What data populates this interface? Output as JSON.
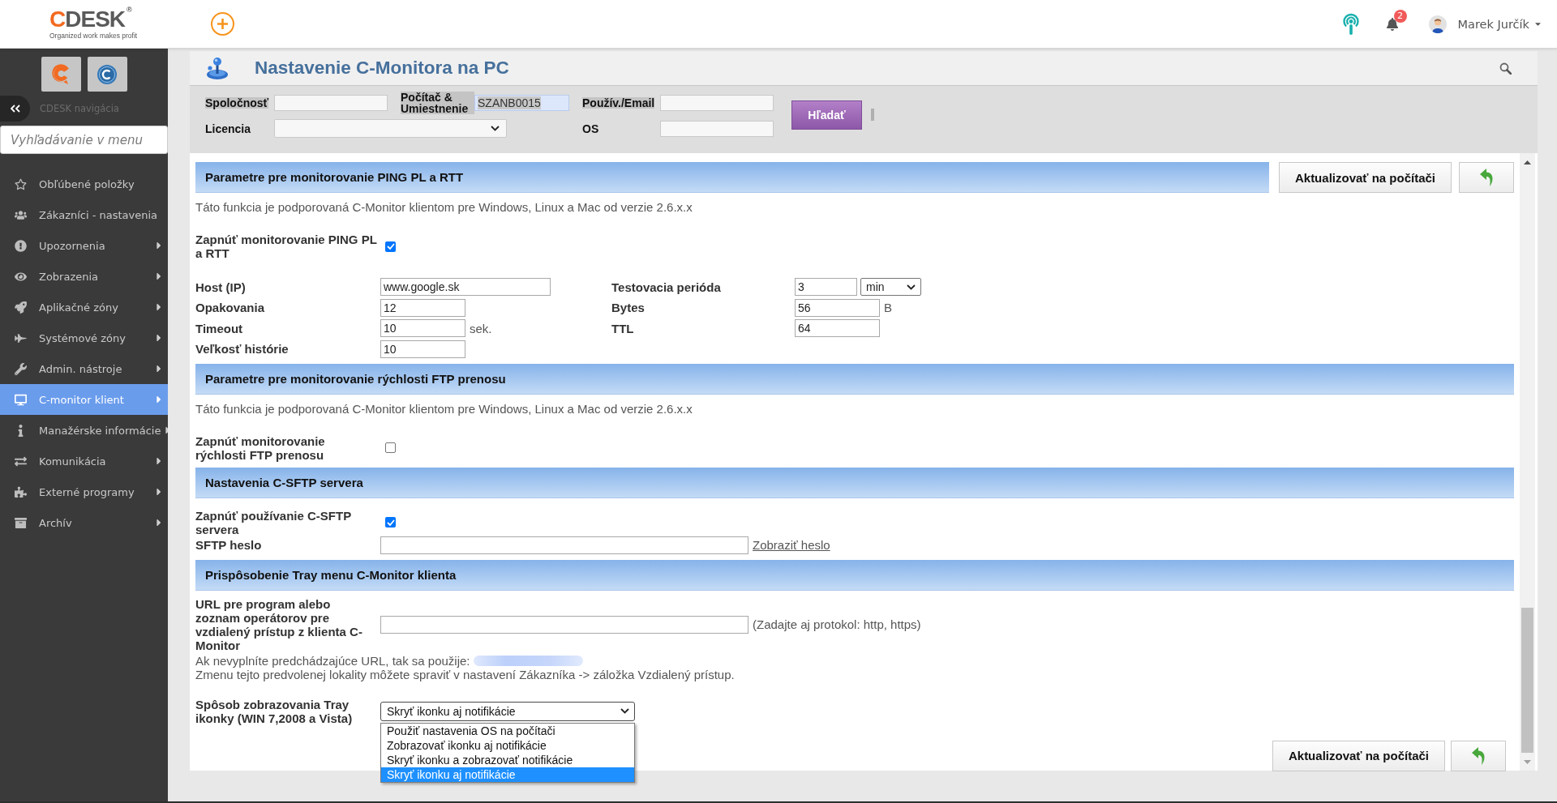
{
  "header": {
    "logo": {
      "accent": "C",
      "text": "DESK",
      "mark": "®",
      "tagline": "Organized work makes profit"
    },
    "notifications": {
      "count": "2"
    },
    "user": {
      "name": "Marek Jurčík"
    }
  },
  "sidebar": {
    "title": "CDESK navigácia",
    "search": {
      "placeholder": "Vyhľadávanie v menu"
    },
    "items": [
      {
        "label": "Obľúbené položky",
        "submenu": false,
        "selected": false
      },
      {
        "label": "Zákazníci - nastavenia",
        "submenu": false,
        "selected": false
      },
      {
        "label": "Upozornenia",
        "submenu": true,
        "selected": false
      },
      {
        "label": "Zobrazenia",
        "submenu": true,
        "selected": false
      },
      {
        "label": "Aplikačné zóny",
        "submenu": true,
        "selected": false
      },
      {
        "label": "Systémové zóny",
        "submenu": true,
        "selected": false
      },
      {
        "label": "Admin. nástroje",
        "submenu": true,
        "selected": false
      },
      {
        "label": "C-monitor klient",
        "submenu": true,
        "selected": true
      },
      {
        "label": "Manažérske informácie",
        "submenu": true,
        "selected": false
      },
      {
        "label": "Komunikácia",
        "submenu": true,
        "selected": false
      },
      {
        "label": "Externé programy",
        "submenu": true,
        "selected": false
      },
      {
        "label": "Archív",
        "submenu": true,
        "selected": false
      }
    ]
  },
  "page": {
    "title": "Nastavenie C-Monitora na PC"
  },
  "filters": {
    "fields": [
      {
        "label": "Spoločnosť",
        "kind": "input",
        "highlighted": true,
        "autofilled": false
      },
      {
        "label": "Počítač & Umiestnenie",
        "kind": "input",
        "value": "SZANB0015",
        "highlighted": true,
        "autofilled": true
      },
      {
        "label": "Použív./Email",
        "kind": "input",
        "highlighted": true,
        "autofilled": false
      },
      {
        "label": "Licencia",
        "kind": "select",
        "highlighted": false,
        "autofilled": false
      },
      {
        "label": "OS",
        "kind": "input",
        "highlighted": false,
        "autofilled": false
      }
    ],
    "search_button": "Hľadať"
  },
  "sections": [
    {
      "title": "Parametre pre monitorovanie PING PL a RTT",
      "actions": {
        "update_label": "Aktualizovať na počítači"
      },
      "rows": [
        {
          "kind": "note",
          "text": "Táto funkcia je podporovaná C-Monitor klientom pre Windows, Linux a Mac od verzie 2.6.x.x"
        },
        {
          "kind": "checkbox",
          "label": "Zapnúť monitorovanie PING PL a RTT",
          "checked": true
        },
        {
          "kind": "fields",
          "fields": [
            {
              "label": "Host (IP)",
              "kind": "text",
              "value": "www.google.sk"
            },
            {
              "label": "Testovacia perióda",
              "kind": "period",
              "value": "3",
              "unit": "min"
            },
            {
              "label": "Opakovania",
              "kind": "number",
              "value": "12"
            },
            {
              "label": "Bytes",
              "kind": "number",
              "value": "56",
              "unit": "B"
            },
            {
              "label": "Timeout",
              "kind": "number",
              "value": "10",
              "unit": "sek."
            },
            {
              "label": "TTL",
              "kind": "number",
              "value": "64"
            },
            {
              "label": "Veľkosť histórie",
              "kind": "number",
              "value": "10"
            }
          ]
        }
      ]
    },
    {
      "title": "Parametre pre monitorovanie rýchlosti FTP prenosu",
      "rows": [
        {
          "kind": "note",
          "text": "Táto funkcia je podporovaná C-Monitor klientom pre Windows, Linux a Mac od verzie 2.6.x.x"
        },
        {
          "kind": "checkbox",
          "label": "Zapnúť monitorovanie rýchlosti FTP prenosu",
          "checked": false
        }
      ]
    },
    {
      "title": "Nastavenia C-SFTP servera",
      "rows": [
        {
          "kind": "checkbox",
          "label": "Zapnúť používanie C-SFTP servera",
          "checked": true
        },
        {
          "kind": "input",
          "label": "SFTP heslo",
          "link": "Zobraziť heslo"
        }
      ]
    },
    {
      "title": "Prispôsobenie Tray menu C-Monitor klienta",
      "rows": [
        {
          "kind": "input",
          "label": "URL pre program alebo zoznam operátorov pre vzdialený prístup z klienta C-Monitor",
          "hint": "(Zadajte aj protokol: http, https)"
        },
        {
          "kind": "help",
          "lines": [
            {
              "text": "Ak nevyplníte predchádzajúce URL, tak sa použije:",
              "redacted_link": true
            },
            {
              "text": "Zmenu tejto predvolenej lokality môžete spraviť v nastavení Zákazníka -> záložka Vzdialený prístup.",
              "redacted_link": false
            }
          ]
        },
        {
          "kind": "select",
          "label": "Spôsob zobrazovania Tray ikonky (WIN 7,2008 a Vista)",
          "value": "Skryť ikonku aj notifikácie",
          "expanded": true,
          "options": [
            {
              "label": "Použiť nastavenia OS na počítači",
              "selected": false
            },
            {
              "label": "Zobrazovať ikonku aj notifikácie",
              "selected": false
            },
            {
              "label": "Skryť ikonku a zobrazovať notifikácie",
              "selected": false
            },
            {
              "label": "Skryť ikonku aj notifikácie",
              "selected": true
            }
          ]
        }
      ]
    }
  ],
  "form_actions": {
    "update_label": "Aktualizovať na počítači"
  }
}
